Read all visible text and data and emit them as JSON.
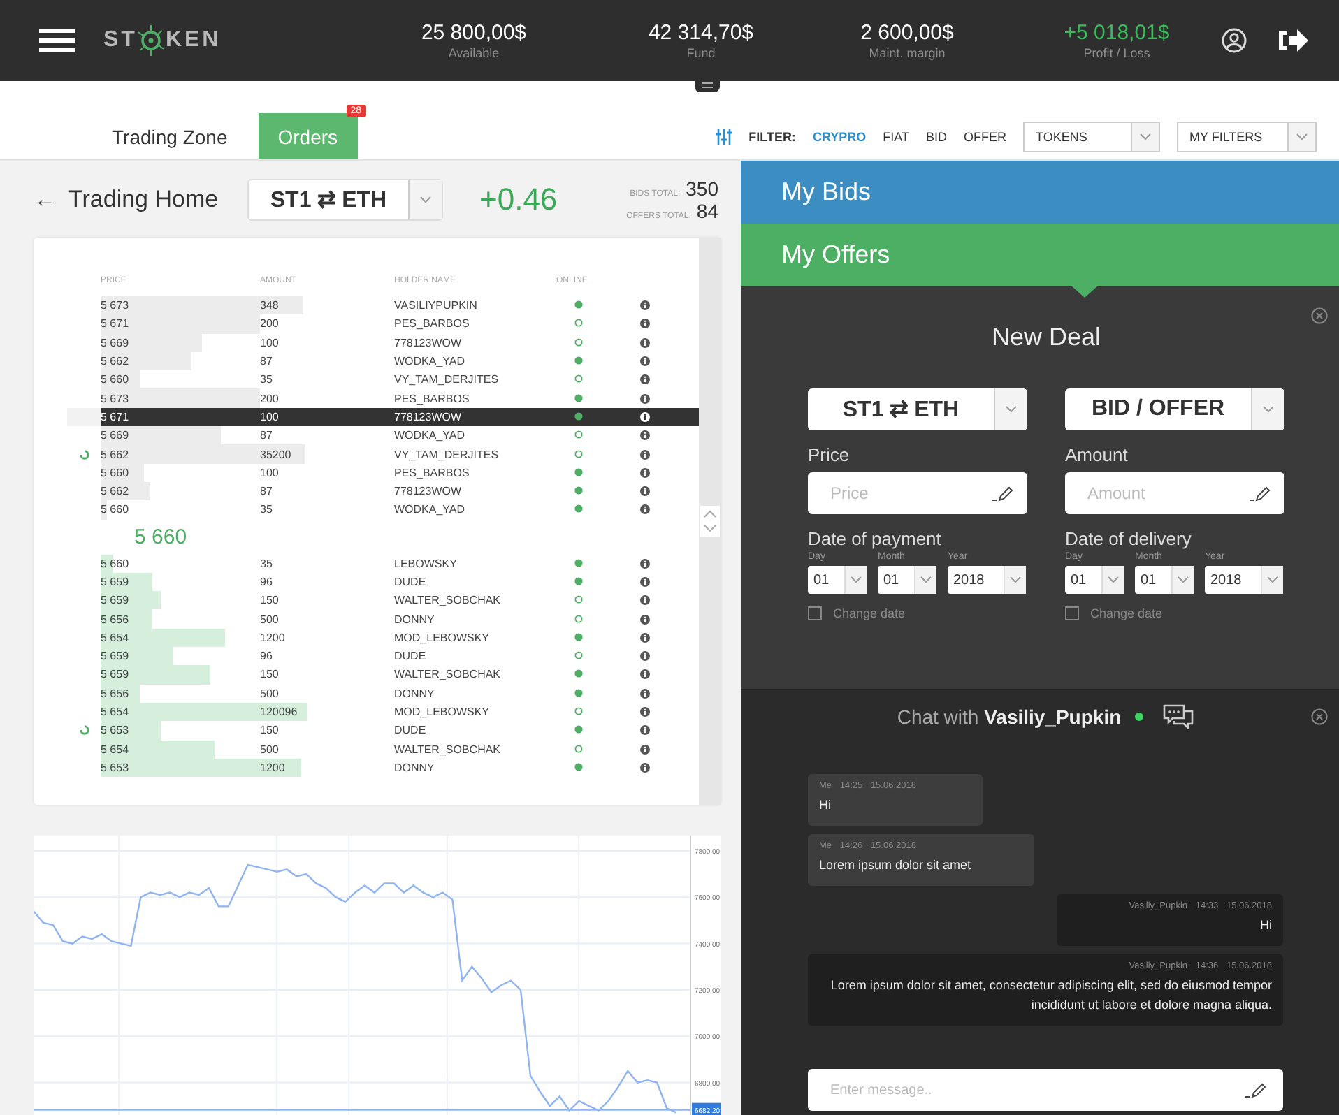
{
  "top_bar": {
    "logo": {
      "left": "ST",
      "right": "KEN"
    },
    "stats": [
      {
        "value": "25 800,00$",
        "label": "Available",
        "positive": false
      },
      {
        "value": "42 314,70$",
        "label": "Fund",
        "positive": false
      },
      {
        "value": "2 600,00$",
        "label": "Maint. margin",
        "positive": false
      },
      {
        "value": "+5 018,01$",
        "label": "Profit / Loss",
        "positive": true
      }
    ]
  },
  "tabs": [
    {
      "label": "Trading Zone",
      "selected": false
    },
    {
      "label": "Orders",
      "selected": true,
      "badge": "28"
    }
  ],
  "filter": {
    "label": "FILTER:",
    "options": [
      {
        "label": "CRYPRO",
        "selected": true
      },
      {
        "label": "FIAT",
        "selected": false
      },
      {
        "label": "BID",
        "selected": false
      },
      {
        "label": "OFFER",
        "selected": false
      }
    ],
    "dropdowns": [
      "TOKENS",
      "MY FILTERS"
    ]
  },
  "trading_home": {
    "back": "←",
    "title": "Trading Home",
    "pair": "ST1 ⇄ ETH",
    "change": "+0.46",
    "totals": [
      {
        "label": "BIDS TOTAL:",
        "value": "350"
      },
      {
        "label": "OFFERS TOTAL:",
        "value": "84"
      }
    ]
  },
  "order_book": {
    "columns": [
      "PRICE",
      "AMOUNT",
      "HOLDER NAME",
      "ONLINE"
    ],
    "asks": [
      {
        "price": "5 673",
        "amount": "348",
        "holder": "VASILIYPUPKIN",
        "online": true,
        "selected": false,
        "loading": false
      },
      {
        "price": "5 671",
        "amount": "200",
        "holder": "PES_BARBOS",
        "online": false,
        "selected": false,
        "loading": false
      },
      {
        "price": "5 669",
        "amount": "100",
        "holder": "778123WOW",
        "online": false,
        "selected": false,
        "loading": false
      },
      {
        "price": "5 662",
        "amount": "87",
        "holder": "WODKA_YAD",
        "online": true,
        "selected": false,
        "loading": false
      },
      {
        "price": "5 660",
        "amount": "35",
        "holder": "VY_TAM_DERJITES",
        "online": false,
        "selected": false,
        "loading": false
      },
      {
        "price": "5 673",
        "amount": "200",
        "holder": "PES_BARBOS",
        "online": true,
        "selected": false,
        "loading": false
      },
      {
        "price": "5 671",
        "amount": "100",
        "holder": "778123WOW",
        "online": true,
        "selected": true,
        "loading": false
      },
      {
        "price": "5 669",
        "amount": "87",
        "holder": "WODKA_YAD",
        "online": false,
        "selected": false,
        "loading": false
      },
      {
        "price": "5 662",
        "amount": "35200",
        "holder": "VY_TAM_DERJITES",
        "online": false,
        "selected": false,
        "loading": true
      },
      {
        "price": "5 660",
        "amount": "100",
        "holder": "PES_BARBOS",
        "online": true,
        "selected": false,
        "loading": false
      },
      {
        "price": "5 662",
        "amount": "87",
        "holder": "778123WOW",
        "online": true,
        "selected": false,
        "loading": false
      },
      {
        "price": "5 660",
        "amount": "35",
        "holder": "WODKA_YAD",
        "online": true,
        "selected": false,
        "loading": false
      }
    ],
    "mid_price": "5 660",
    "bids": [
      {
        "price": "5 660",
        "amount": "35",
        "holder": "LEBOWSKY",
        "online": true,
        "selected": false,
        "loading": false
      },
      {
        "price": "5 659",
        "amount": "96",
        "holder": "DUDE",
        "online": true,
        "selected": false,
        "loading": false
      },
      {
        "price": "5 659",
        "amount": "150",
        "holder": "WALTER_SOBCHAK",
        "online": false,
        "selected": false,
        "loading": false
      },
      {
        "price": "5 656",
        "amount": "500",
        "holder": "DONNY",
        "online": false,
        "selected": false,
        "loading": false
      },
      {
        "price": "5 654",
        "amount": "1200",
        "holder": "MOD_LEBOWSKY",
        "online": true,
        "selected": false,
        "loading": false
      },
      {
        "price": "5 659",
        "amount": "96",
        "holder": "DUDE",
        "online": false,
        "selected": false,
        "loading": false
      },
      {
        "price": "5 659",
        "amount": "150",
        "holder": "WALTER_SOBCHAK",
        "online": true,
        "selected": false,
        "loading": false
      },
      {
        "price": "5 656",
        "amount": "500",
        "holder": "DONNY",
        "online": true,
        "selected": false,
        "loading": false
      },
      {
        "price": "5 654",
        "amount": "120096",
        "holder": "MOD_LEBOWSKY",
        "online": false,
        "selected": false,
        "loading": false
      },
      {
        "price": "5 653",
        "amount": "150",
        "holder": "DUDE",
        "online": true,
        "selected": false,
        "loading": true
      },
      {
        "price": "5 654",
        "amount": "500",
        "holder": "WALTER_SOBCHAK",
        "online": false,
        "selected": false,
        "loading": false
      },
      {
        "price": "5 653",
        "amount": "1200",
        "holder": "DONNY",
        "online": true,
        "selected": false,
        "loading": false
      }
    ]
  },
  "price_chart": {
    "chart_data": {
      "type": "line",
      "ylim": [
        6660,
        7866
      ],
      "yticks": [
        {
          "value": 7800,
          "label": "7800.00"
        },
        {
          "value": 7600,
          "label": "7600.00"
        },
        {
          "value": 7400,
          "label": "7400.00"
        },
        {
          "value": 7200,
          "label": "7200.00"
        },
        {
          "value": 7000,
          "label": "7000.00"
        },
        {
          "value": 6800,
          "label": "6800.00"
        }
      ],
      "grid": true,
      "series": [
        {
          "color": "#8fb4f0",
          "values": [
            7540,
            7490,
            7480,
            7410,
            7400,
            7430,
            7420,
            7440,
            7410,
            7400,
            7390,
            7600,
            7620,
            7610,
            7620,
            7600,
            7620,
            7610,
            7640,
            7560,
            7560,
            7650,
            7740,
            7730,
            7720,
            7710,
            7720,
            7690,
            7700,
            7660,
            7640,
            7600,
            7580,
            7620,
            7650,
            7620,
            7660,
            7660,
            7620,
            7650,
            7620,
            7600,
            7620,
            7590,
            7240,
            7300,
            7250,
            7190,
            7220,
            7240,
            7200,
            6830,
            6760,
            6700,
            6740,
            6680,
            6720,
            6700,
            6680,
            6720,
            6780,
            6850,
            6800,
            6810,
            6800,
            6690,
            6670
          ]
        }
      ],
      "ref_lines": [
        {
          "axis": "y",
          "value": 6682.2,
          "label": "6682.20"
        }
      ]
    }
  },
  "my_bids": {
    "title": "My Bids",
    "expanded": false
  },
  "my_offers": {
    "title": "My Offers",
    "expanded": true
  },
  "new_deal": {
    "title": "New Deal",
    "pair": "ST1 ⇄ ETH",
    "side": "BID / OFFER",
    "fields": [
      {
        "label": "Price",
        "placeholder": "Price"
      },
      {
        "label": "Amount",
        "placeholder": "Amount"
      }
    ],
    "dates": [
      {
        "label": "Date of payment",
        "parts": [
          {
            "label": "Day",
            "value": "01"
          },
          {
            "label": "Month",
            "value": "01"
          },
          {
            "label": "Year",
            "value": "2018"
          }
        ],
        "change": {
          "label": "Change date",
          "checked": false
        }
      },
      {
        "label": "Date of delivery",
        "parts": [
          {
            "label": "Day",
            "value": "01"
          },
          {
            "label": "Month",
            "value": "01"
          },
          {
            "label": "Year",
            "value": "2018"
          }
        ],
        "change": {
          "label": "Change date",
          "checked": false
        }
      }
    ]
  },
  "chat": {
    "title": "Chat with",
    "user": "Vasiliy_Pupkin",
    "online": true,
    "messages": [
      {
        "author": "Me",
        "time": "14:25",
        "date": "15.06.2018",
        "text": "Hi",
        "mine": true
      },
      {
        "author": "Me",
        "time": "14:26",
        "date": "15.06.2018",
        "text": "Lorem ipsum dolor sit amet",
        "mine": true
      },
      {
        "author": "Vasiliy_Pupkin",
        "time": "14:33",
        "date": "15.06.2018",
        "text": "Hi",
        "mine": false
      },
      {
        "author": "Vasiliy_Pupkin",
        "time": "14:36",
        "date": "15.06.2018",
        "text": "Lorem ipsum dolor sit amet, consectetur adipiscing elit, sed do eiusmod tempor incididunt ut labore et dolore magna aliqua.",
        "mine": false
      }
    ],
    "input": {
      "placeholder": "Enter message.."
    }
  }
}
